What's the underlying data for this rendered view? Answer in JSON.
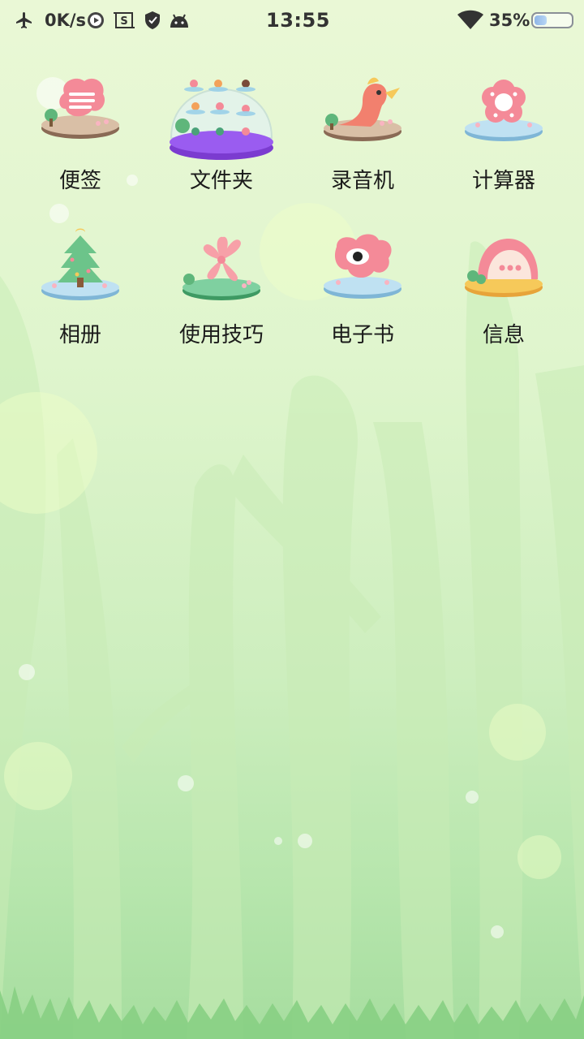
{
  "status_bar": {
    "net_speed": "0K/s",
    "time": "13:55",
    "battery_percent": "35%",
    "battery_level": 0.35,
    "icons": [
      "airplane-icon",
      "media-play-icon",
      "screenshot-icon",
      "shield-icon",
      "android-icon",
      "wifi-icon",
      "battery-icon"
    ]
  },
  "apps": [
    {
      "label": "便签",
      "icon": "notes-icon"
    },
    {
      "label": "文件夹",
      "icon": "folder-icon"
    },
    {
      "label": "录音机",
      "icon": "recorder-icon"
    },
    {
      "label": "计算器",
      "icon": "calculator-icon"
    },
    {
      "label": "相册",
      "icon": "gallery-icon"
    },
    {
      "label": "使用技巧",
      "icon": "tips-icon"
    },
    {
      "label": "电子书",
      "icon": "ebook-icon"
    },
    {
      "label": "信息",
      "icon": "messages-icon"
    }
  ],
  "colors": {
    "background_top": "#eaf8d6",
    "background_bottom": "#a6dd9f",
    "accent_pink": "#f48a98",
    "accent_purple": "#8c46e0"
  }
}
